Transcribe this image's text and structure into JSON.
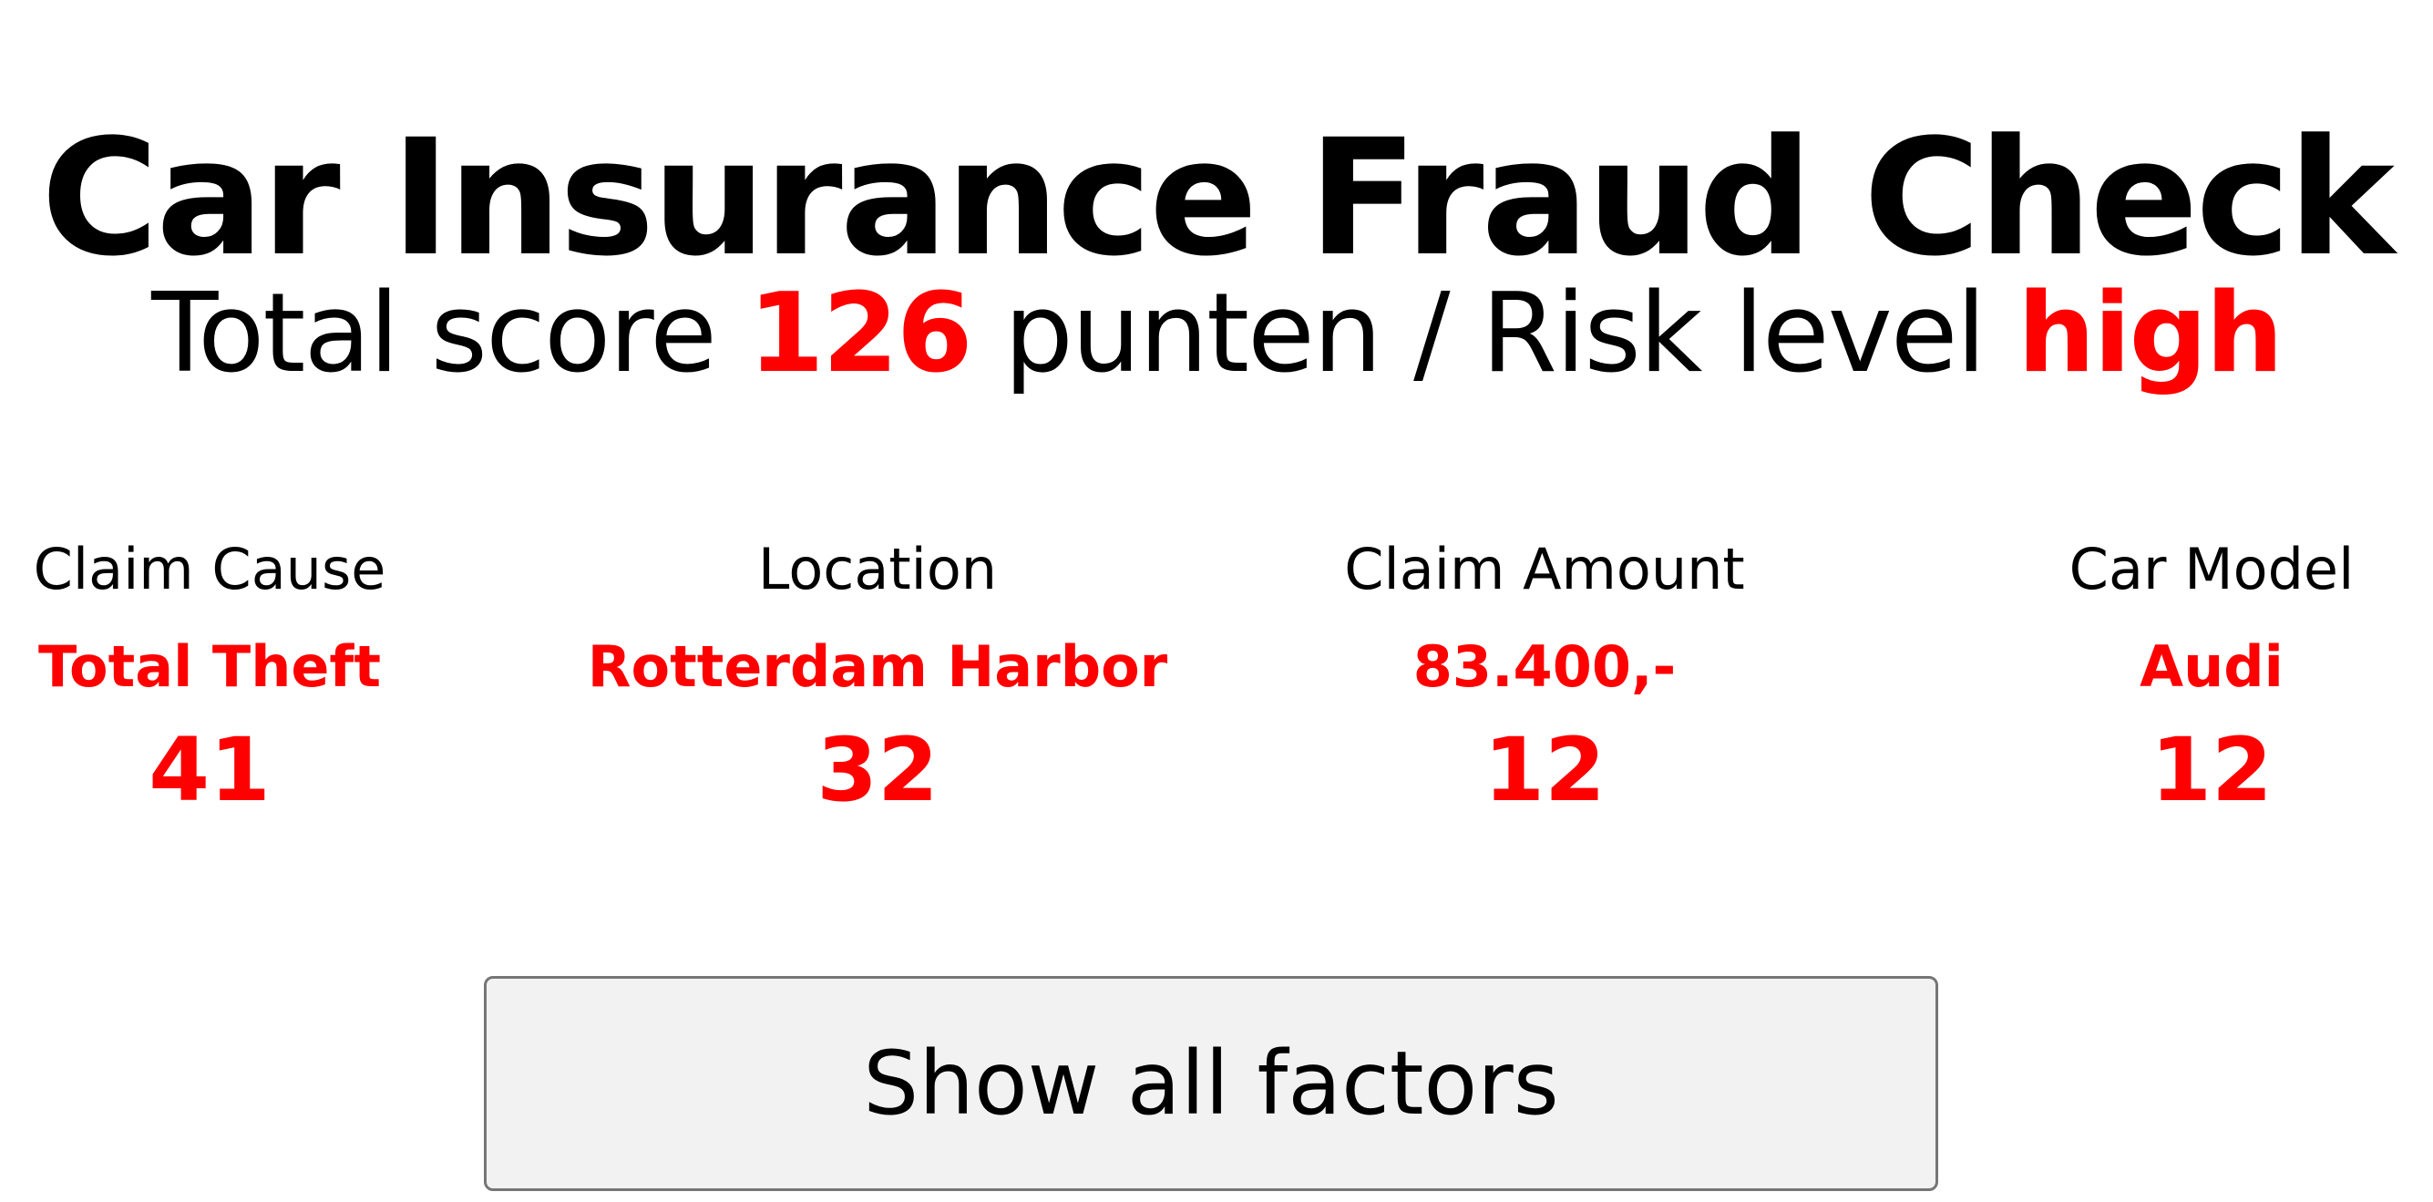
{
  "title": "Car Insurance Fraud Check",
  "summary": {
    "prefix": "Total score",
    "score": "126",
    "unit": "punten / Risk level",
    "risk_level": "high"
  },
  "factors": [
    {
      "label": "Claim Cause",
      "value": "Total Theft",
      "points": "41"
    },
    {
      "label": "Location",
      "value": "Rotterdam Harbor",
      "points": "32"
    },
    {
      "label": "Claim Amount",
      "value": "83.400,-",
      "points": "12"
    },
    {
      "label": "Car Model",
      "value": "Audi",
      "points": "12"
    }
  ],
  "actions": {
    "show_all_label": "Show all factors"
  },
  "colors": {
    "accent": "#ff0000",
    "text": "#000000",
    "button_bg": "#f2f2f2",
    "button_border": "#767676"
  }
}
